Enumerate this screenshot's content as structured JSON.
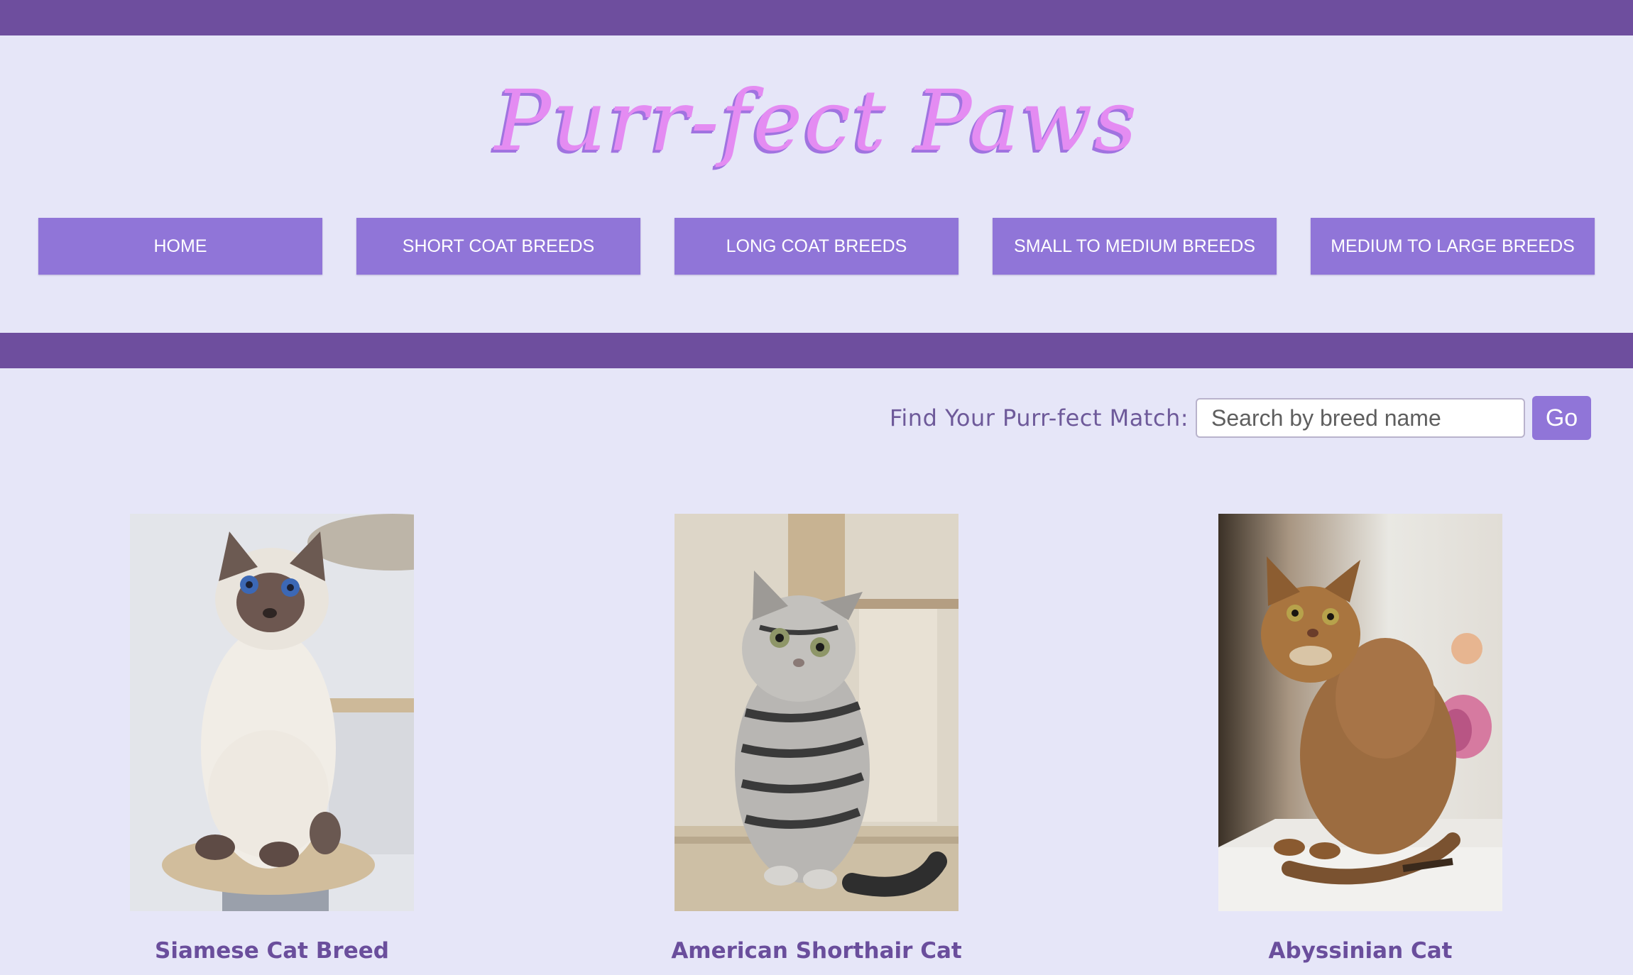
{
  "header": {
    "logo_text": "Purr-fect Paws",
    "colors": {
      "bar": "#6e4e9e",
      "logo": "#e48cf2",
      "nav_button": "#9075d8",
      "background": "#e6e6f8"
    }
  },
  "nav": {
    "items": [
      {
        "label": "HOME"
      },
      {
        "label": "SHORT COAT BREEDS"
      },
      {
        "label": "LONG COAT BREEDS"
      },
      {
        "label": "SMALL TO MEDIUM BREEDS"
      },
      {
        "label": "MEDIUM TO LARGE BREEDS"
      }
    ]
  },
  "search": {
    "label": "Find Your Purr-fect Match:",
    "placeholder": "Search by breed name",
    "value": "",
    "button_label": "Go"
  },
  "breeds": [
    {
      "name": "Siamese Cat Breed",
      "image_icon": "siamese-cat-photo"
    },
    {
      "name": "American Shorthair Cat",
      "image_icon": "american-shorthair-cat-photo"
    },
    {
      "name": "Abyssinian Cat",
      "image_icon": "abyssinian-cat-photo"
    }
  ]
}
